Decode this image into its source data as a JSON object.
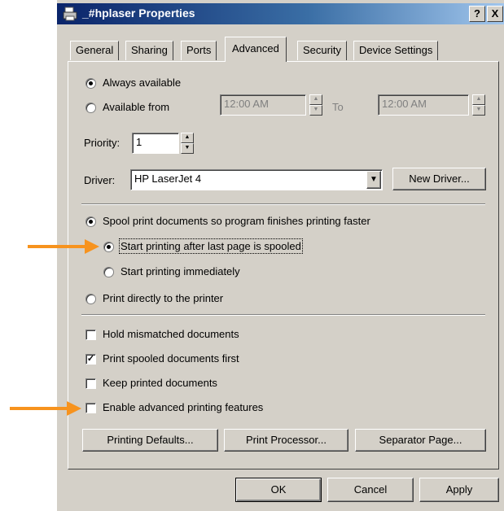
{
  "window": {
    "title": "_#hplaser Properties",
    "help_btn": "?",
    "close_btn": "X"
  },
  "tabs": [
    "General",
    "Sharing",
    "Ports",
    "Advanced",
    "Security",
    "Device Settings"
  ],
  "availability": {
    "always_label": "Always available",
    "from_label": "Available from",
    "from_time": "12:00 AM",
    "to_label": "To",
    "to_time": "12:00 AM"
  },
  "priority": {
    "label": "Priority:",
    "value": "1"
  },
  "driver": {
    "label": "Driver:",
    "value": "HP LaserJet 4",
    "new_driver_button": "New Driver..."
  },
  "spool": {
    "spool_label": "Spool print documents so program finishes printing faster",
    "after_last_label": "Start printing after last page is spooled",
    "immediately_label": "Start printing immediately",
    "direct_label": "Print directly to the printer"
  },
  "options": {
    "hold_mismatched": "Hold mismatched documents",
    "print_spooled_first": "Print spooled documents first",
    "keep_printed": "Keep printed documents",
    "enable_advanced": "Enable advanced printing features"
  },
  "buttons": {
    "printing_defaults": "Printing Defaults...",
    "print_processor": "Print Processor...",
    "separator_page": "Separator Page...",
    "ok": "OK",
    "cancel": "Cancel",
    "apply": "Apply"
  },
  "colors": {
    "arrow": "#f7931e",
    "title_bar": "#0a246a",
    "dialog_face": "#d4d0c8"
  }
}
